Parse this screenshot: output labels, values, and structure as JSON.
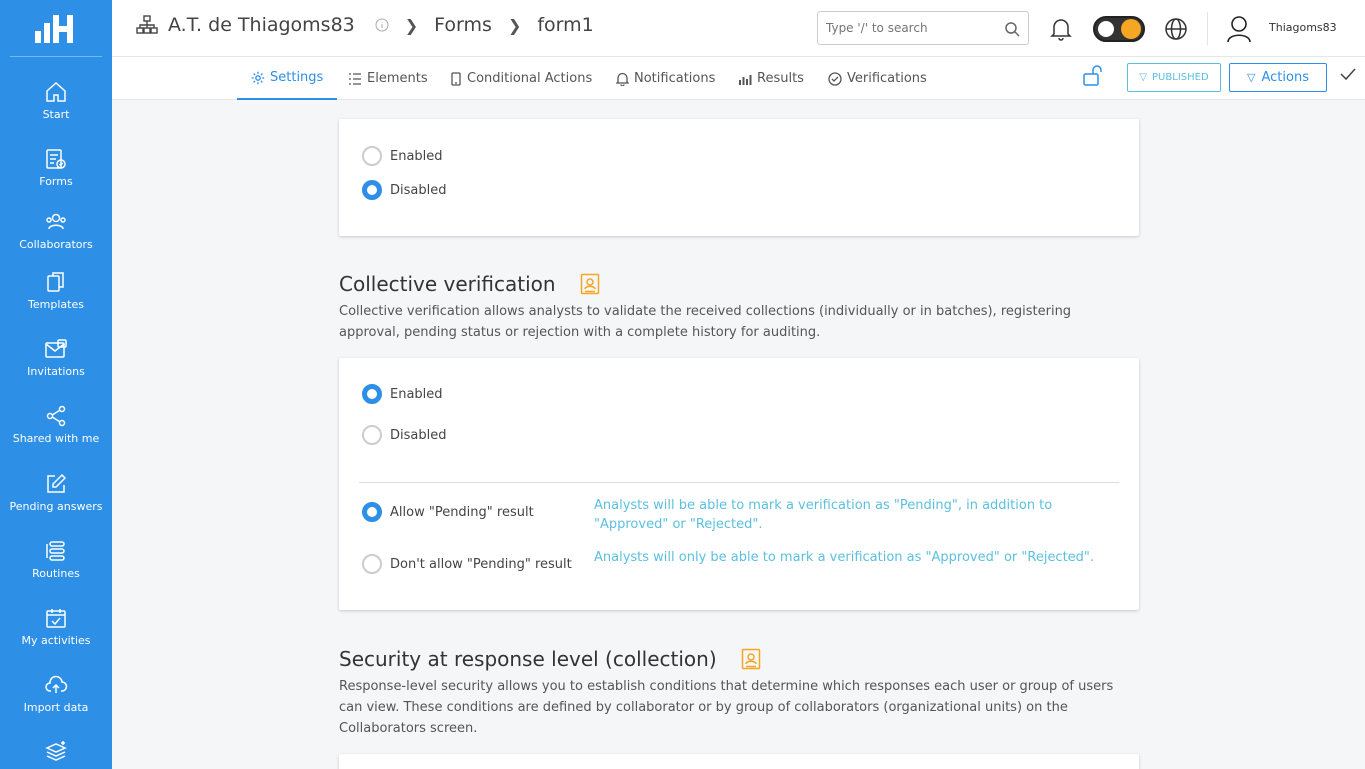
{
  "sidebar": {
    "items": [
      {
        "label": "Start",
        "icon": "home-icon"
      },
      {
        "label": "Forms",
        "icon": "forms-icon"
      },
      {
        "label": "Collaborators",
        "icon": "users-icon"
      },
      {
        "label": "Templates",
        "icon": "templates-icon"
      },
      {
        "label": "Invitations",
        "icon": "invitations-icon"
      },
      {
        "label": "Shared with me",
        "icon": "share-icon"
      },
      {
        "label": "Pending answers",
        "icon": "edit-icon"
      },
      {
        "label": "Routines",
        "icon": "routines-icon"
      },
      {
        "label": "My activities",
        "icon": "calendar-check-icon"
      },
      {
        "label": "Import data",
        "icon": "cloud-upload-icon"
      }
    ]
  },
  "header": {
    "breadcrumb": [
      "A.T. de Thiagoms83",
      "Forms",
      "form1"
    ],
    "search_placeholder": "Type '/' to search",
    "username": "Thiagoms83"
  },
  "tabs": [
    {
      "label": "Settings",
      "icon": "gear-icon"
    },
    {
      "label": "Elements",
      "icon": "list-icon"
    },
    {
      "label": "Conditional Actions",
      "icon": "phone-icon"
    },
    {
      "label": "Notifications",
      "icon": "bell-icon"
    },
    {
      "label": "Results",
      "icon": "bar-chart-icon"
    },
    {
      "label": "Verifications",
      "icon": "check-circle-icon"
    }
  ],
  "toolbar": {
    "published_label": "PUBLISHED",
    "actions_label": "Actions"
  },
  "card1": {
    "options": [
      "Enabled",
      "Disabled"
    ],
    "selected": "Disabled"
  },
  "collective": {
    "title": "Collective verification",
    "description": "Collective verification allows analysts to validate the received collections (individually or in batches), registering approval, pending status or rejection with a complete history for auditing.",
    "options": [
      "Enabled",
      "Disabled"
    ],
    "selected": "Enabled",
    "pending_options": [
      {
        "label": "Allow \"Pending\" result",
        "hint": "Analysts will be able to mark a verification as \"Pending\", in addition to \"Approved\" or \"Rejected\"."
      },
      {
        "label": "Don't allow \"Pending\" result",
        "hint": "Analysts will only be able to mark a verification as \"Approved\" or \"Rejected\"."
      }
    ],
    "pending_selected": "Allow \"Pending\" result"
  },
  "security": {
    "title": "Security at response level (collection)",
    "description": "Response-level security allows you to establish conditions that determine which responses each user or group of users can view. These conditions are defined by collaborator or by group of collaborators (organizational units) on the Collaborators screen."
  },
  "colors": {
    "primary": "#2d8fe5",
    "hint": "#5bc0de",
    "badge": "#f5a623"
  }
}
